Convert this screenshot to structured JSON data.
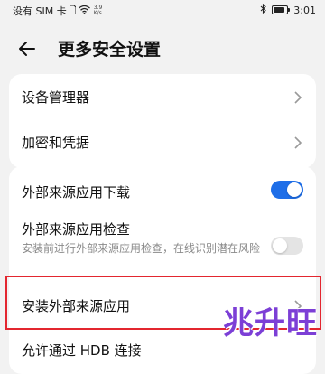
{
  "status": {
    "carrier": "没有 SIM 卡",
    "speed_value": "3.9",
    "speed_unit": "K/s",
    "time": "3:01",
    "battery_level": 0.85
  },
  "header": {
    "title": "更多安全设置"
  },
  "card1": {
    "items": [
      {
        "label": "设备管理器",
        "icon": "chevron-right-icon"
      },
      {
        "label": "加密和凭据",
        "icon": "chevron-right-icon"
      }
    ]
  },
  "card2": {
    "items": [
      {
        "label": "外部来源应用下载",
        "toggle": true
      },
      {
        "label": "外部来源应用检查",
        "sub": "安装前进行外部来源应用检查，在线识别潜在风险",
        "toggle": false
      },
      {
        "label": "安装外部来源应用",
        "icon": "chevron-right-icon"
      },
      {
        "label": "允许通过 HDB 连接"
      }
    ]
  },
  "watermark": {
    "text": "兆升旺"
  },
  "colors": {
    "accent": "#1e6ee8",
    "highlight": "#e3262f",
    "background": "#f2f2f2",
    "watermark": "#7c3fd6"
  }
}
